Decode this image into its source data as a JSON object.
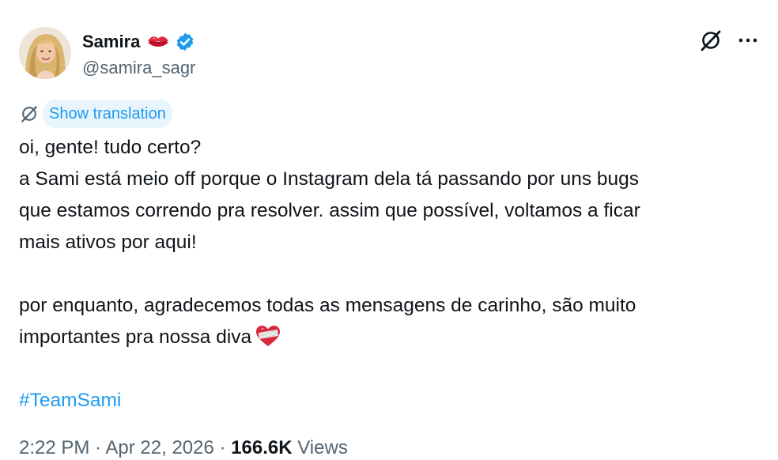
{
  "user": {
    "display_name": "Samira",
    "handle": "@samira_sagr",
    "name_emoji": "kiss-mark-icon",
    "verified": true
  },
  "actions": {
    "grok_icon": "grok-slash-icon",
    "more_icon": "more-dots-icon"
  },
  "translation": {
    "label": "Show translation"
  },
  "tweet": {
    "line1": "oi, gente! tudo certo?",
    "line2": "a Sami está meio off porque o Instagram dela tá passando por uns bugs",
    "line3": "que estamos correndo pra resolver. assim que possível, voltamos a ficar",
    "line4": "mais ativos por aqui!",
    "line5": "por enquanto, agradecemos todas as mensagens de carinho, são muito",
    "line6": "importantes pra nossa diva",
    "line6_emoji": "mending-heart-icon",
    "hashtag": "#TeamSami"
  },
  "meta": {
    "time": "2:22 PM",
    "sep1": " · ",
    "date": "Apr 22, 2026",
    "sep2": " · ",
    "views_count": "166.6K",
    "views_label": " Views"
  },
  "colors": {
    "accent": "#1d9bf0",
    "secondary_text": "#536471",
    "primary_text": "#0f1419",
    "translation_bg": "#e8f5fd"
  }
}
